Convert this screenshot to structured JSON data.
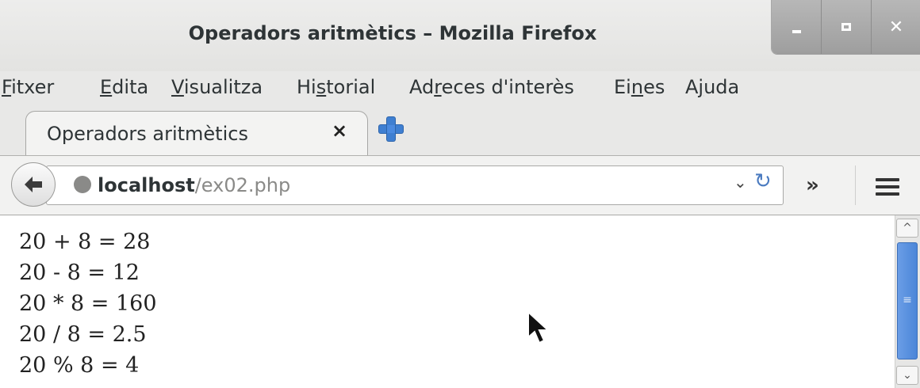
{
  "window": {
    "title": "Operadors aritmètics – Mozilla Firefox",
    "controls": {
      "minimize": "_",
      "close": "✕"
    }
  },
  "menu": {
    "items": [
      {
        "name": "fitxer",
        "label": "Fitxer",
        "mnemonic": "F",
        "rest": "itxer"
      },
      {
        "name": "edita",
        "label": "Edita",
        "mnemonic": "E",
        "rest": "dita"
      },
      {
        "name": "visualitza",
        "label": "Visualitza",
        "mnemonic": "V",
        "rest": "isualitza"
      },
      {
        "name": "historial",
        "label": "Historial",
        "pre": "Hi",
        "mnemonic": "s",
        "rest": "torial"
      },
      {
        "name": "adreces",
        "label": "Adreces d'interès",
        "pre": "Ad",
        "mnemonic": "r",
        "rest": "eces d'interès"
      },
      {
        "name": "eines",
        "label": "Eines",
        "pre": "Ei",
        "mnemonic": "n",
        "rest": "es"
      },
      {
        "name": "ajuda",
        "label": "Ajuda",
        "pre": "A",
        "mnemonic": "j",
        "rest": "uda"
      }
    ]
  },
  "tabs": [
    {
      "title": "Operadors aritmètics",
      "close": "×",
      "active": true
    }
  ],
  "navbar": {
    "url_host": "localhost",
    "url_path": "/ex02.php",
    "dropdown": "⌄",
    "reload": "↻",
    "overflow": "»"
  },
  "content": {
    "lines": [
      "20 + 8 = 28",
      "20 - 8 = 12",
      "20 * 8 = 160",
      "20 / 8 = 2.5",
      "20 % 8 = 4"
    ]
  },
  "icons": {
    "back": "back-arrow-icon",
    "globe": "globe-icon",
    "new_tab": "plus-icon",
    "menu": "hamburger-icon"
  },
  "colors": {
    "accent": "#3f7fd1",
    "scroll_thumb": "#4b86d8"
  }
}
